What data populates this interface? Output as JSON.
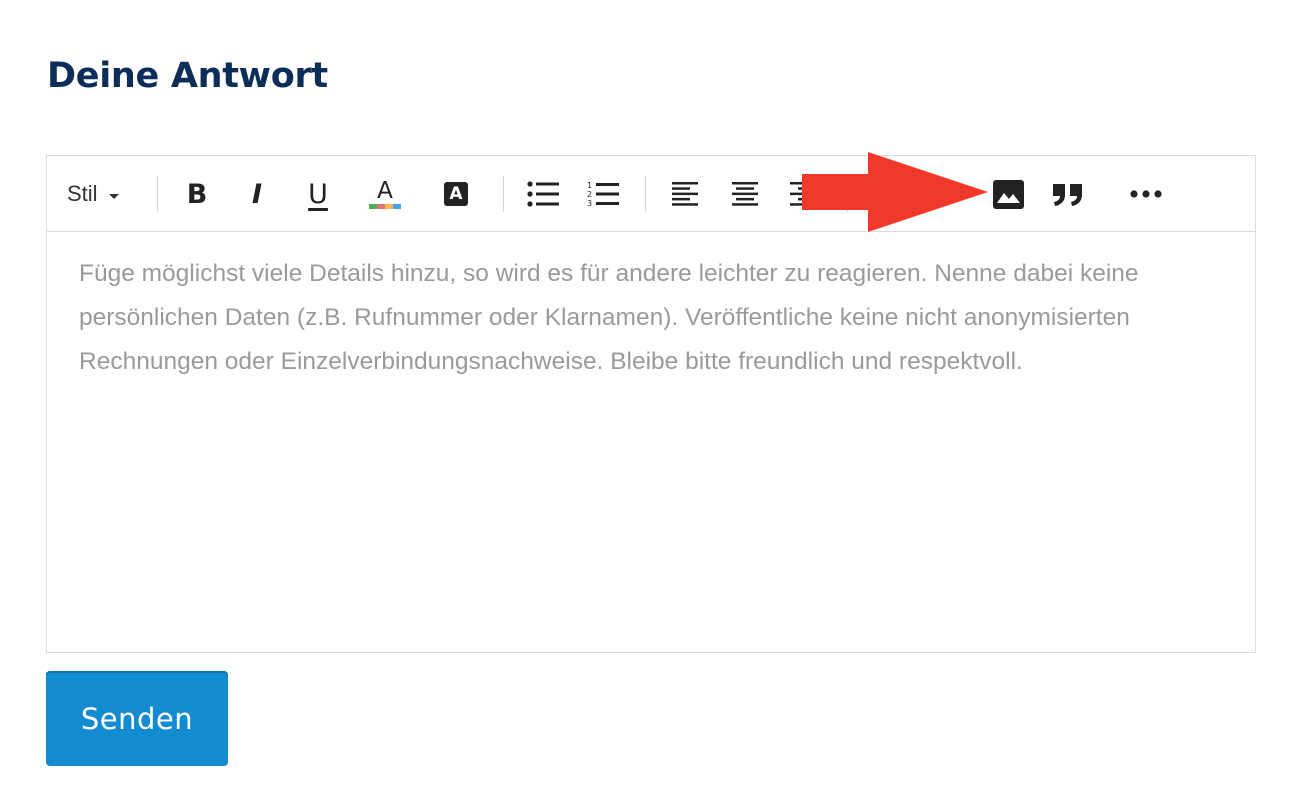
{
  "page": {
    "title": "Deine Antwort"
  },
  "toolbar": {
    "style_label": "Stil",
    "bold_glyph": "B",
    "italic_glyph": "I",
    "underline_glyph": "U",
    "text_color_glyph": "A",
    "highlight_glyph": "A",
    "icons": {
      "style_dropdown": "caret-down-icon",
      "bullet_list": "bullet-list-icon",
      "numbered_list": "numbered-list-icon",
      "align_left": "align-left-icon",
      "align_center": "align-center-icon",
      "align_right": "align-right-icon",
      "image": "image-icon",
      "quote": "quote-icon",
      "more": "more-icon"
    },
    "text_color_swatch": [
      "#4caf50",
      "#e57373",
      "#ffb74d",
      "#42a5f5"
    ]
  },
  "editor": {
    "placeholder": "Füge möglichst viele Details hinzu, so wird es für andere leichter zu reagieren. Nenne dabei keine persönlichen Daten (z.B. Rufnummer oder Klarnamen). Veröffentliche keine nicht anonymisierten Rechnungen oder Einzelverbindungsnachweise. Bleibe bitte freundlich und respektvoll."
  },
  "submit": {
    "label": "Senden"
  },
  "annotation": {
    "arrow_color": "#f0392b"
  },
  "colors": {
    "title": "#0c2d57",
    "button": "#138bd0",
    "placeholder": "#9a9a9a",
    "border": "#dcdcdc"
  }
}
